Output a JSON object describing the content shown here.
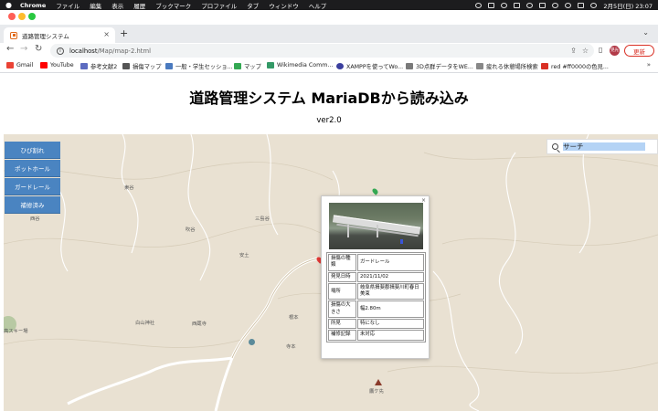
{
  "os_menubar": {
    "app": "Chrome",
    "items": [
      "ファイル",
      "編集",
      "表示",
      "履歴",
      "ブックマーク",
      "プロファイル",
      "タブ",
      "ウィンドウ",
      "ヘルプ"
    ],
    "datetime": "2月5日(日) 23:07"
  },
  "tab": {
    "title": "道路管理システム",
    "close": "×"
  },
  "new_tab_label": "+",
  "address": {
    "host": "localhost",
    "path": "/Map/map-2.html"
  },
  "profile_initials": "晃光",
  "update_label": "更新",
  "bookmarks": [
    {
      "label": "Gmail",
      "color": "#ea4335"
    },
    {
      "label": "YouTube",
      "color": "#ff0000"
    },
    {
      "label": "参考文献2",
      "color": "#5c6bc0"
    },
    {
      "label": "損傷マップ",
      "color": "#555555"
    },
    {
      "label": "一般・学生セッショ...",
      "color": "#4a7abf"
    },
    {
      "label": "マップ",
      "color": "#34a853"
    },
    {
      "label": "Wikimedia Comm...",
      "color": "#339966"
    },
    {
      "label": "XAMPPを使ってWo...",
      "color": "#3b3f9e"
    },
    {
      "label": "3D点群データをWE...",
      "color": "#7a7a7a"
    },
    {
      "label": "疲れる休憩場所検索",
      "color": "#888888"
    },
    {
      "label": "red #ff0000の色見...",
      "color": "#d93025"
    }
  ],
  "page": {
    "title": "道路管理システム MariaDBから読み込み",
    "version": "ver2.0"
  },
  "controls": [
    "ひび割れ",
    "ポットホール",
    "ガードレール",
    "補修済み"
  ],
  "search": {
    "placeholder": "サーチ"
  },
  "map_labels": [
    "東谷",
    "吹谷",
    "三島谷",
    "西谷",
    "白山神社",
    "西蔵寺",
    "根本",
    "寺本",
    "鷹ケ先",
    "高スキー場",
    "安土"
  ],
  "popup": {
    "close": "×",
    "rows": [
      {
        "key": "損傷の種類",
        "value": "ガードレール"
      },
      {
        "key": "発見日時",
        "value": "2021/11/02"
      },
      {
        "key": "場所",
        "value": "岐阜県揖斐郡揖斐川町春日美束"
      },
      {
        "key": "損傷の大きさ",
        "value": "幅2.80m"
      },
      {
        "key": "所見",
        "value": "特になし"
      },
      {
        "key": "補修記録",
        "value": "未対応"
      }
    ]
  },
  "colors": {
    "control_blue": "#4a84c1",
    "map_bg": "#e9e1d2",
    "river": "#ffffff",
    "update_red": "#d93025"
  }
}
